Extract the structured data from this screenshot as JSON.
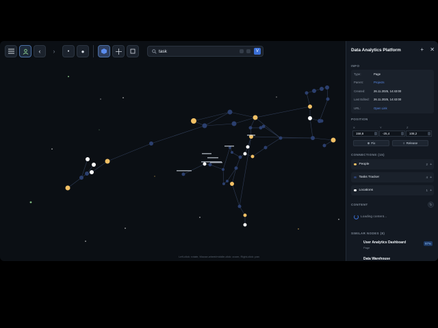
{
  "toolbar": {
    "search_value": "task",
    "filter_badge": "V"
  },
  "canvas": {
    "hint": "Left-click: rotate, Mouse-wheel/middle-click: zoom, Right-click: pan",
    "node_colors": {
      "default": "#2b3f6e",
      "highlight": "#f2c065",
      "selected": "#ffffff",
      "secondary": "#8fd18f"
    }
  },
  "panel": {
    "title": "Data Analytics Platform",
    "info_label": "INFO",
    "info": [
      {
        "key": "Type:",
        "value": "Page"
      },
      {
        "key": "Parent:",
        "value": "Projects"
      },
      {
        "key": "Created:",
        "value": "26.11.2025, 14:43:00"
      },
      {
        "key": "Last Edited:",
        "value": "26.11.2025, 14:43:00"
      },
      {
        "key": "URL:",
        "value": "Open Link"
      }
    ],
    "position_label": "POSITION",
    "position": {
      "x_label": "X",
      "x": "158,8",
      "y_label": "Y",
      "y": "-25,4",
      "z_label": "Z",
      "z": "108,2",
      "fix": "Fix",
      "release": "Release"
    },
    "connections_label": "CONNECTIONS (15)",
    "connections": [
      {
        "name": "People",
        "count": "2",
        "color": "#f2c065"
      },
      {
        "name": "Tasks Tracker",
        "count": "4",
        "color": "#2b3f6e"
      },
      {
        "name": "Locations",
        "count": "1",
        "color": "#ffffff"
      }
    ],
    "content_label": "CONTENT",
    "content_loading": "Loading content...",
    "similar_label": "SIMILAR NODES (8)",
    "similar": [
      {
        "title": "User Analytics Dashboard",
        "sub": "Page",
        "pct": "97%"
      },
      {
        "title": "Data Warehouse",
        "sub": "",
        "pct": ""
      }
    ]
  }
}
